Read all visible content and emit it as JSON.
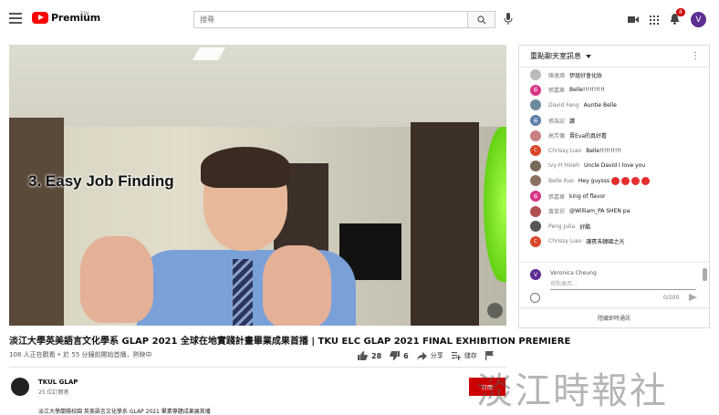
{
  "header": {
    "logo_text": "Premium",
    "logo_region": "TW",
    "search_placeholder": "搜尋",
    "notification_count": "8",
    "avatar_letter": "V"
  },
  "video": {
    "caption": "3. Easy Job Finding",
    "title": "淡江大學英美語言文化學系 GLAP 2021 全球在地實踐計畫畢業成果首播 | TKU ELC GLAP 2021 FINAL EXHIBITION PREMIERE",
    "meta": "108 人正在觀看 • 於 55 分鐘前開始首播，熱映中",
    "likes": "28",
    "dislikes": "6",
    "share_label": "分享",
    "save_label": "儲存"
  },
  "channel": {
    "name": "TKUL GLAP",
    "subscribers": "25 位訂閱者",
    "description": "淡江大學蘭陽校園 英美語言文化學系 GLAP 2021 畢業專題成果展首播",
    "subscribe_label": "訂閱"
  },
  "watermark": "淡江時報社",
  "chat": {
    "header": "重點聊天室訊息",
    "messages": [
      {
        "author": "陳逸璋",
        "text": "伊瑄好會化妝",
        "color": "#bbbbbb",
        "initial": ""
      },
      {
        "author": "張嘉華",
        "text": "Belle!!!!!!!!!!",
        "color": "#d63384",
        "initial": "張"
      },
      {
        "author": "David Feng",
        "text": "Auntie Belle",
        "color": "#6c8a9e",
        "initial": ""
      },
      {
        "author": "張為宏",
        "text": "讚",
        "color": "#5b7ea8",
        "initial": "張"
      },
      {
        "author": "高芳儀",
        "text": "賣Eva的真好看",
        "color": "#c98080",
        "initial": ""
      },
      {
        "author": "Chrissy Liao",
        "text": "Belle!!!!!!!!!!",
        "color": "#d9472b",
        "initial": "C"
      },
      {
        "author": "Ivy H Hsieh",
        "text": "Uncle David I love you",
        "color": "#7a6a5a",
        "initial": ""
      },
      {
        "author": "Belle Kuo",
        "text": "Hey guysss",
        "color": "#8a7060",
        "initial": "",
        "hearts": 4
      },
      {
        "author": "張嘉華",
        "text": "king of flavor",
        "color": "#d63384",
        "initial": "張"
      },
      {
        "author": "黃苗祁",
        "text": "@William_PA SHEN pa",
        "color": "#b05050",
        "initial": ""
      },
      {
        "author": "Peng Julia",
        "text": "好酷",
        "color": "#555555",
        "initial": ""
      },
      {
        "author": "Chrissy Liao",
        "text": "讓賓朱韓國之光",
        "color": "#d9472b",
        "initial": "C"
      }
    ],
    "composer_name": "Veronica Cheung",
    "composer_placeholder": "寫點東西...",
    "char_count": "0/200",
    "footer": "隱藏即時通訊"
  }
}
